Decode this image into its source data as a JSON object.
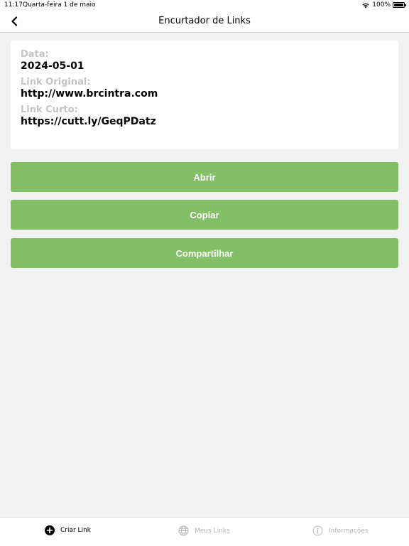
{
  "status_bar": {
    "time": "11:17",
    "date": "Quarta-feira 1 de maio",
    "battery": "100%"
  },
  "nav": {
    "title": "Encurtador de Links"
  },
  "details": {
    "date_label": "Data:",
    "date_value": "2024-05-01",
    "original_label": "Link Original:",
    "original_value": "http://www.brcintra.com",
    "short_label": "Link Curto:",
    "short_value": "https://cutt.ly/GeqPDatz"
  },
  "actions": {
    "open_label": "Abrir",
    "copy_label": "Copiar",
    "share_label": "Compartilhar"
  },
  "tabs": [
    {
      "label": "Criar Link",
      "icon": "plus-circle-icon",
      "active": true
    },
    {
      "label": "Meus Links",
      "icon": "globe-icon",
      "active": false
    },
    {
      "label": "Informações",
      "icon": "info-icon",
      "active": false
    }
  ],
  "colors": {
    "accent": "#83bf66",
    "background": "#f2f2f2",
    "label_gray": "#c4c4c4",
    "inactive_tab": "#b5b5b5"
  }
}
